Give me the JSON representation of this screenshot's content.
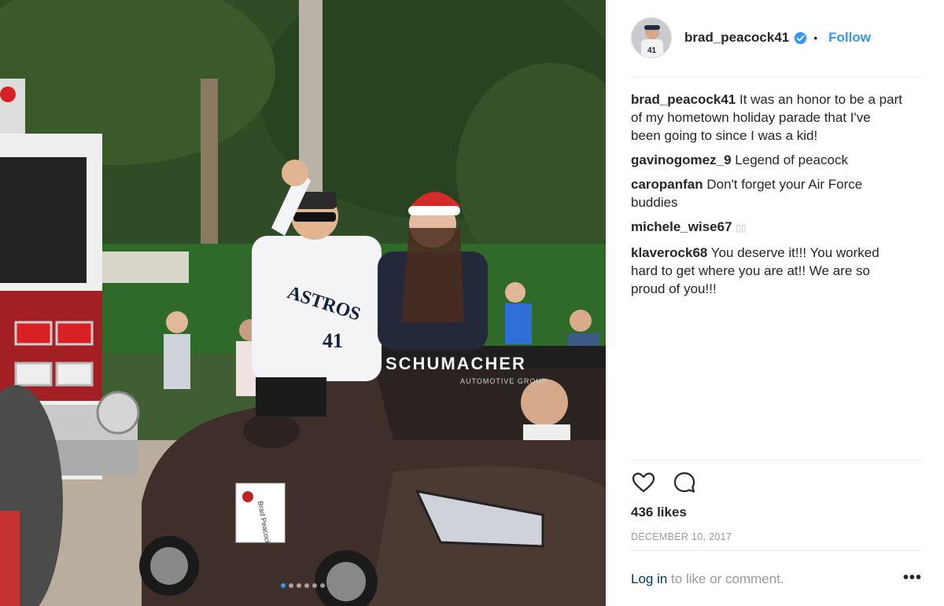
{
  "post": {
    "image_alt": "Parade photo",
    "carousel": {
      "count": 6,
      "active": 0
    }
  },
  "header": {
    "username": "brad_peacock41",
    "separator": "•",
    "follow_label": "Follow"
  },
  "comments": [
    {
      "user": "brad_peacock41",
      "text": "It was an honor to be a part of my hometown holiday parade that I've been going to since I was a kid!"
    },
    {
      "user": "gavinogomez_9",
      "text": "Legend of peacock"
    },
    {
      "user": "caropanfan",
      "text": "Don't forget your Air Force buddies"
    },
    {
      "user": "michele_wise67",
      "text": "▯▯"
    },
    {
      "user": "klaverock68",
      "text": "You deserve it!!! You worked hard to get where you are at!! We are so proud of you!!!"
    }
  ],
  "stats": {
    "likes": "436 likes",
    "date": "DECEMBER 10, 2017"
  },
  "footer": {
    "login_link": "Log in",
    "login_rest": " to like or comment.",
    "more_label": "•••"
  },
  "scene_text": {
    "car_banner": "SCHUMACHER",
    "car_banner_sub": "AUTOMOTIVE GROUP",
    "jersey": "ASTROS",
    "jersey_number": "41",
    "door_sign": "Brad Peacock"
  },
  "colors": {
    "accent": "#3897f0",
    "link_dark": "#003569",
    "muted": "#999999"
  }
}
